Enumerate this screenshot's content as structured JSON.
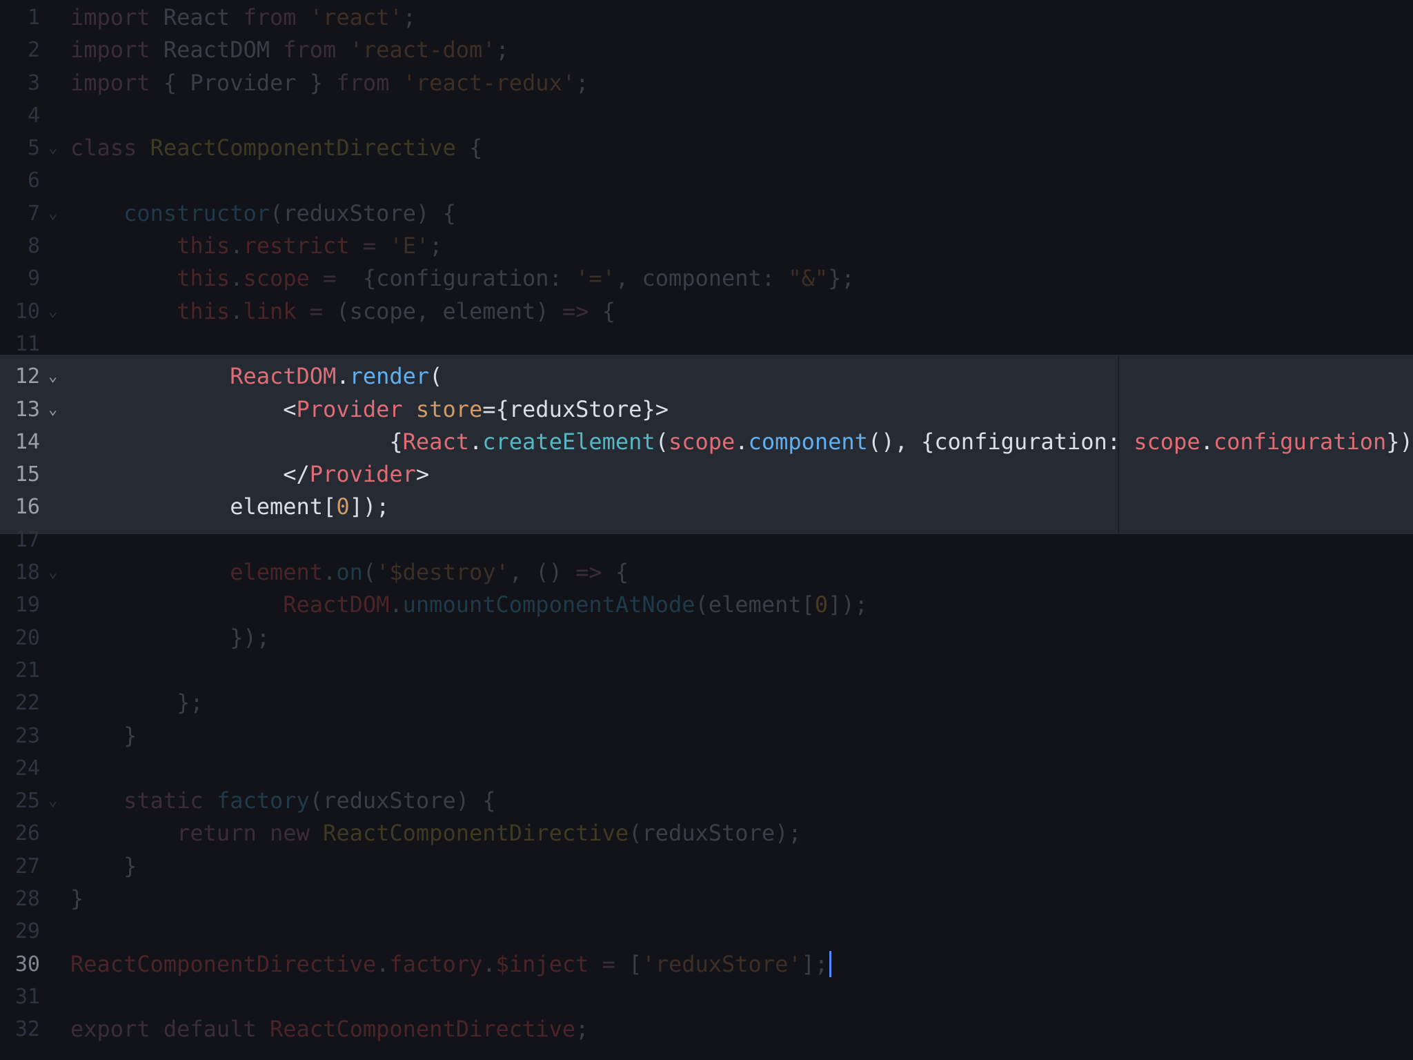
{
  "editor": {
    "theme_colors": {
      "background": "#111318",
      "highlight_band": "#262b33",
      "cursor": "#528bff"
    },
    "lines": [
      {
        "n": "1",
        "fold": "",
        "tokens": [
          [
            "kw",
            "import"
          ],
          [
            "plain",
            " "
          ],
          [
            "plain",
            "React"
          ],
          [
            "plain",
            " "
          ],
          [
            "kw",
            "from"
          ],
          [
            "plain",
            " "
          ],
          [
            "str",
            "'react'"
          ],
          [
            "plain",
            ";"
          ]
        ]
      },
      {
        "n": "2",
        "fold": "",
        "tokens": [
          [
            "kw",
            "import"
          ],
          [
            "plain",
            " ReactDOM "
          ],
          [
            "kw",
            "from"
          ],
          [
            "plain",
            " "
          ],
          [
            "str",
            "'react-dom'"
          ],
          [
            "plain",
            ";"
          ]
        ]
      },
      {
        "n": "3",
        "fold": "",
        "tokens": [
          [
            "kw",
            "import"
          ],
          [
            "plain",
            " { Provider } "
          ],
          [
            "kw",
            "from"
          ],
          [
            "plain",
            " "
          ],
          [
            "str",
            "'react-redux'"
          ],
          [
            "plain",
            ";"
          ]
        ]
      },
      {
        "n": "4",
        "fold": "",
        "tokens": []
      },
      {
        "n": "5",
        "fold": "⌄",
        "tokens": [
          [
            "kw",
            "class"
          ],
          [
            "plain",
            " "
          ],
          [
            "cls",
            "ReactComponentDirective"
          ],
          [
            "plain",
            " {"
          ]
        ]
      },
      {
        "n": "6",
        "fold": "",
        "tokens": []
      },
      {
        "n": "7",
        "fold": "⌄",
        "tokens": [
          [
            "plain",
            "    "
          ],
          [
            "fn",
            "constructor"
          ],
          [
            "plain",
            "(reduxStore) {"
          ]
        ]
      },
      {
        "n": "8",
        "fold": "",
        "tokens": [
          [
            "plain",
            "        "
          ],
          [
            "this",
            "this"
          ],
          [
            "plain",
            "."
          ],
          [
            "prop",
            "restrict"
          ],
          [
            "plain",
            " "
          ],
          [
            "op",
            "="
          ],
          [
            "plain",
            " "
          ],
          [
            "str",
            "'E'"
          ],
          [
            "plain",
            ";"
          ]
        ]
      },
      {
        "n": "9",
        "fold": "",
        "tokens": [
          [
            "plain",
            "        "
          ],
          [
            "this",
            "this"
          ],
          [
            "plain",
            "."
          ],
          [
            "prop",
            "scope"
          ],
          [
            "plain",
            " "
          ],
          [
            "op",
            "="
          ],
          [
            "plain",
            "  {configuration: "
          ],
          [
            "str",
            "'='"
          ],
          [
            "plain",
            ", component: "
          ],
          [
            "str",
            "\"&\""
          ],
          [
            "plain",
            "};"
          ]
        ]
      },
      {
        "n": "10",
        "fold": "⌄",
        "tokens": [
          [
            "plain",
            "        "
          ],
          [
            "this",
            "this"
          ],
          [
            "plain",
            "."
          ],
          [
            "prop",
            "link"
          ],
          [
            "plain",
            " "
          ],
          [
            "op",
            "="
          ],
          [
            "plain",
            " (scope, element) "
          ],
          [
            "op",
            "=>"
          ],
          [
            "plain",
            " {"
          ]
        ]
      },
      {
        "n": "11",
        "fold": "",
        "tokens": []
      },
      {
        "n": "12",
        "fold": "⌄",
        "hl": true,
        "tokens": [
          [
            "plain",
            "            "
          ],
          [
            "cls",
            "ReactDOM"
          ],
          [
            "plain",
            "."
          ],
          [
            "fn",
            "render"
          ],
          [
            "plain",
            "("
          ]
        ]
      },
      {
        "n": "13",
        "fold": "⌄",
        "hl": true,
        "tokens": [
          [
            "plain",
            "                <"
          ],
          [
            "tag",
            "Provider"
          ],
          [
            "plain",
            " "
          ],
          [
            "attr",
            "store"
          ],
          [
            "plain",
            "={reduxStore}>"
          ]
        ]
      },
      {
        "n": "14",
        "fold": "",
        "hl": true,
        "tokens": [
          [
            "plain",
            "                        {"
          ],
          [
            "cls",
            "React"
          ],
          [
            "plain",
            "."
          ],
          [
            "fn2",
            "createElement"
          ],
          [
            "plain",
            "("
          ],
          [
            "var",
            "scope"
          ],
          [
            "plain",
            "."
          ],
          [
            "fn",
            "component"
          ],
          [
            "plain",
            "(), {configuration: "
          ],
          [
            "var",
            "scope"
          ],
          [
            "plain",
            "."
          ],
          [
            "var",
            "configuration"
          ],
          [
            "plain",
            "})}"
          ]
        ]
      },
      {
        "n": "15",
        "fold": "",
        "hl": true,
        "tokens": [
          [
            "plain",
            "                </"
          ],
          [
            "tag",
            "Provider"
          ],
          [
            "plain",
            ">"
          ]
        ]
      },
      {
        "n": "16",
        "fold": "",
        "hl": true,
        "tokens": [
          [
            "plain",
            "            element["
          ],
          [
            "num",
            "0"
          ],
          [
            "plain",
            "]);"
          ]
        ]
      },
      {
        "n": "17",
        "fold": "",
        "tokens": []
      },
      {
        "n": "18",
        "fold": "⌄",
        "tokens": [
          [
            "plain",
            "            "
          ],
          [
            "this",
            "element"
          ],
          [
            "plain",
            "."
          ],
          [
            "fn",
            "on"
          ],
          [
            "plain",
            "("
          ],
          [
            "str",
            "'$destroy'"
          ],
          [
            "plain",
            ", () "
          ],
          [
            "op",
            "=>"
          ],
          [
            "plain",
            " {"
          ]
        ]
      },
      {
        "n": "19",
        "fold": "",
        "tokens": [
          [
            "plain",
            "                "
          ],
          [
            "this",
            "ReactDOM"
          ],
          [
            "plain",
            "."
          ],
          [
            "fn",
            "unmountComponentAtNode"
          ],
          [
            "plain",
            "(element["
          ],
          [
            "num",
            "0"
          ],
          [
            "plain",
            "]);"
          ]
        ]
      },
      {
        "n": "20",
        "fold": "",
        "tokens": [
          [
            "plain",
            "            });"
          ]
        ]
      },
      {
        "n": "21",
        "fold": "",
        "tokens": []
      },
      {
        "n": "22",
        "fold": "",
        "tokens": [
          [
            "plain",
            "        };"
          ]
        ]
      },
      {
        "n": "23",
        "fold": "",
        "tokens": [
          [
            "plain",
            "    }"
          ]
        ]
      },
      {
        "n": "24",
        "fold": "",
        "tokens": []
      },
      {
        "n": "25",
        "fold": "⌄",
        "tokens": [
          [
            "plain",
            "    "
          ],
          [
            "kw",
            "static"
          ],
          [
            "plain",
            " "
          ],
          [
            "fn",
            "factory"
          ],
          [
            "plain",
            "(reduxStore) {"
          ]
        ]
      },
      {
        "n": "26",
        "fold": "",
        "tokens": [
          [
            "plain",
            "        "
          ],
          [
            "kw",
            "return"
          ],
          [
            "plain",
            " "
          ],
          [
            "kw",
            "new"
          ],
          [
            "plain",
            " "
          ],
          [
            "cls",
            "ReactComponentDirective"
          ],
          [
            "plain",
            "(reduxStore);"
          ]
        ]
      },
      {
        "n": "27",
        "fold": "",
        "tokens": [
          [
            "plain",
            "    }"
          ]
        ]
      },
      {
        "n": "28",
        "fold": "",
        "tokens": [
          [
            "plain",
            "}"
          ]
        ]
      },
      {
        "n": "29",
        "fold": "",
        "tokens": []
      },
      {
        "n": "30",
        "fold": "",
        "cur": true,
        "tokens": [
          [
            "cls",
            "ReactComponentDirective"
          ],
          [
            "plain",
            "."
          ],
          [
            "prop",
            "factory"
          ],
          [
            "plain",
            "."
          ],
          [
            "prop",
            "$inject"
          ],
          [
            "plain",
            " "
          ],
          [
            "op",
            "="
          ],
          [
            "plain",
            " ["
          ],
          [
            "str",
            "'reduxStore'"
          ],
          [
            "plain",
            "];"
          ]
        ]
      },
      {
        "n": "31",
        "fold": "",
        "tokens": []
      },
      {
        "n": "32",
        "fold": "",
        "tokens": [
          [
            "kw",
            "export"
          ],
          [
            "plain",
            " "
          ],
          [
            "kw",
            "default"
          ],
          [
            "plain",
            " "
          ],
          [
            "this",
            "ReactComponentDirective"
          ],
          [
            "plain",
            ";"
          ]
        ]
      }
    ]
  }
}
